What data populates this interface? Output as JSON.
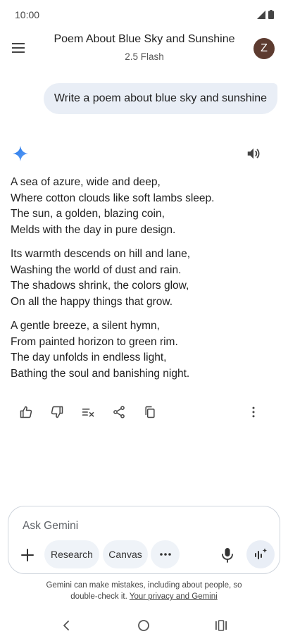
{
  "status_bar": {
    "time": "10:00"
  },
  "header": {
    "title": "Poem About Blue Sky and Sunshine",
    "model": "2.5 Flash",
    "avatar_letter": "Z",
    "avatar_color": "#5d3b30"
  },
  "user_message": "Write a poem about blue sky and sunshine",
  "response": {
    "stanzas": [
      [
        "A sea of azure, wide and deep,",
        "Where cotton clouds like soft lambs sleep.",
        "The sun, a golden, blazing coin,",
        "Melds with the day in pure design."
      ],
      [
        "Its warmth descends on hill and lane,",
        "Washing the world of dust and rain.",
        "The shadows shrink, the colors glow,",
        "On all the happy things that grow."
      ],
      [
        "A gentle breeze, a silent hymn,",
        "From painted horizon to green rim.",
        "The day unfolds in endless light,",
        "Bathing the soul and banishing night."
      ]
    ]
  },
  "composer": {
    "placeholder": "Ask Gemini",
    "chips": {
      "research": "Research",
      "canvas": "Canvas"
    }
  },
  "footer": {
    "disclaimer_line1": "Gemini can make mistakes, including about people, so",
    "disclaimer_line2": "double-check it.",
    "privacy_link": "Your privacy and Gemini"
  },
  "icons": {
    "menu": "hamburger-menu-icon",
    "spark": "gemini-spark-icon",
    "speaker": "speaker-icon",
    "actions": [
      "thumbs-up-icon",
      "thumbs-down-icon",
      "modify-response-icon",
      "share-icon",
      "copy-icon",
      "more-vert-icon"
    ],
    "composer": [
      "plus-icon",
      "more-horiz-icon",
      "mic-icon",
      "live-icon"
    ]
  },
  "colors": {
    "accent_blue": "#4285f4",
    "bubble": "#e9eef6",
    "chip": "#eff3f8"
  }
}
